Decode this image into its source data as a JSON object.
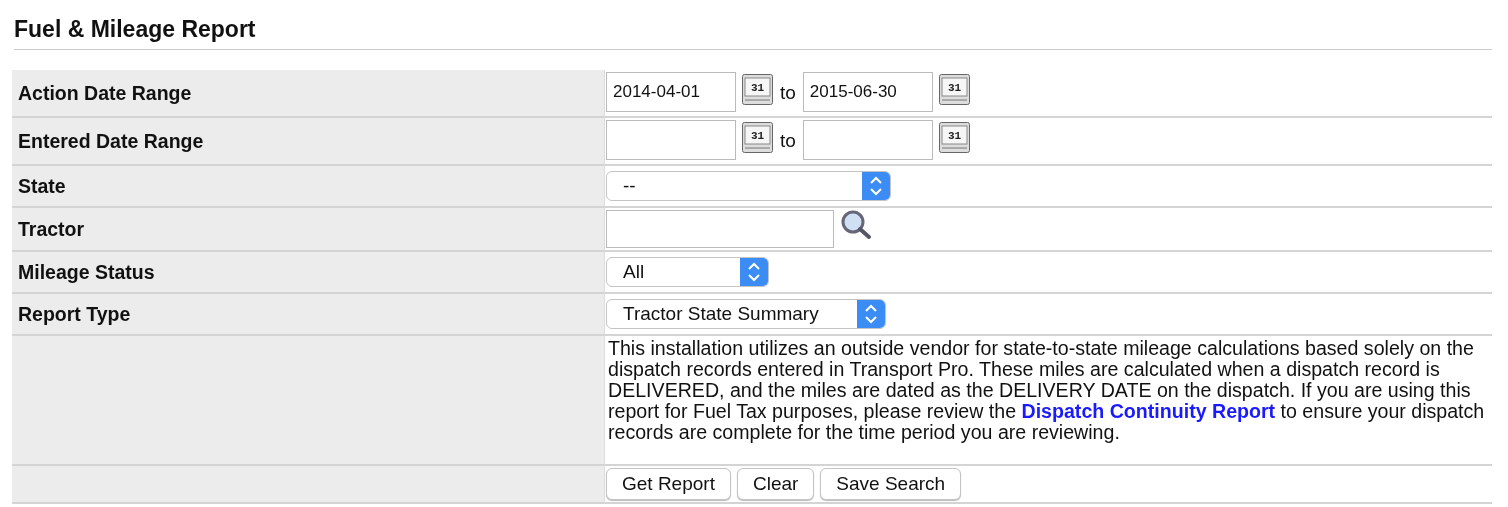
{
  "title": "Fuel & Mileage Report",
  "rows": [
    {
      "kind": "dates",
      "label": "Action Date Range",
      "from": {
        "value": "2014-04-01",
        "calendar": "31"
      },
      "separator": "to",
      "to": {
        "value": "2015-06-30",
        "calendar": "31"
      }
    },
    {
      "kind": "dates",
      "label": "Entered Date Range",
      "from": {
        "calendar": "31"
      },
      "separator": "to",
      "to": {
        "calendar": "31"
      }
    },
    {
      "kind": "select",
      "label": "State",
      "value": "--"
    },
    {
      "kind": "lookup",
      "label": "Tractor"
    },
    {
      "kind": "select",
      "label": "Mileage Status",
      "value": "All"
    },
    {
      "kind": "select",
      "label": "Report Type",
      "value": "Tractor State Summary"
    },
    {
      "kind": "note",
      "before": "This installation utilizes an outside vendor for state-to-state mileage calculations based solely on the dispatch records entered in Transport Pro. These miles are calculated when a dispatch record is DELIVERED, and the miles are dated as the DELIVERY DATE on the dispatch. If you are using this report for Fuel Tax purposes, please review the ",
      "link": "Dispatch Continuity Report",
      "after": " to ensure your dispatch records are complete for the time period you are reviewing."
    },
    {
      "kind": "buttons",
      "buttons": [
        "Get Report",
        "Clear",
        "Save Search"
      ]
    }
  ]
}
